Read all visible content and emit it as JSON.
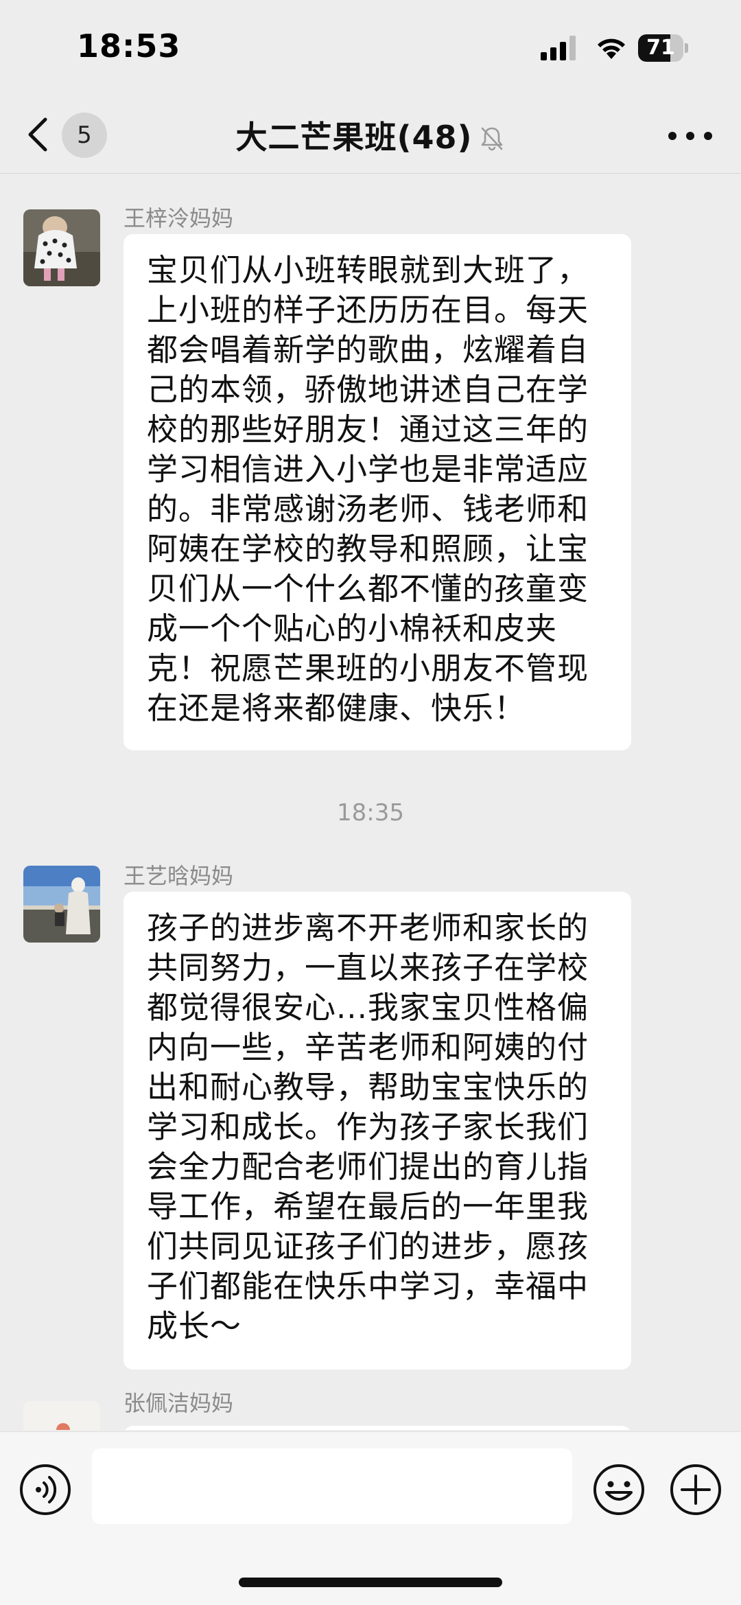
{
  "status_bar": {
    "time": "18:53",
    "battery_level": "71",
    "battery_fraction": 0.71
  },
  "nav": {
    "unread_count": "5",
    "title": "大二芒果班(48)",
    "back_icon": "chevron-left-icon",
    "mute_icon": "bell-slash-icon",
    "more_icon": "ellipsis-icon"
  },
  "messages": [
    {
      "sender": "王梓泠妈妈",
      "text": "宝贝们从小班转眼就到大班了，上小班的样子还历历在目。每天都会唱着新学的歌曲，炫耀着自己的本领，骄傲地讲述自己在学校的那些好朋友！通过这三年的学习相信进入小学也是非常适应的。非常感谢汤老师、钱老师和阿姨在学校的教导和照顾，让宝贝们从一个什么都不懂的孩童变成一个个贴心的小棉袄和皮夹克！祝愿芒果班的小朋友不管现在还是将来都健康、快乐！"
    },
    {
      "timestamp": "18:35"
    },
    {
      "sender": "王艺晗妈妈",
      "text": "孩子的进步离不开老师和家长的共同努力，一直以来孩子在学校都觉得很安心...我家宝贝性格偏内向一些，辛苦老师和阿姨的付出和耐心教导，帮助宝宝快乐的学习和成长。作为孩子家长我们会全力配合老师们提出的育儿指导工作，希望在最后的一年里我们共同见证孩子们的进步，愿孩子们都能在快乐中学习，幸福中成长～"
    },
    {
      "sender": "张佩洁妈妈"
    }
  ],
  "input_bar": {
    "value": "",
    "voice_icon": "voice-icon",
    "emoji_icon": "smiley-icon",
    "plus_icon": "plus-circle-icon"
  }
}
